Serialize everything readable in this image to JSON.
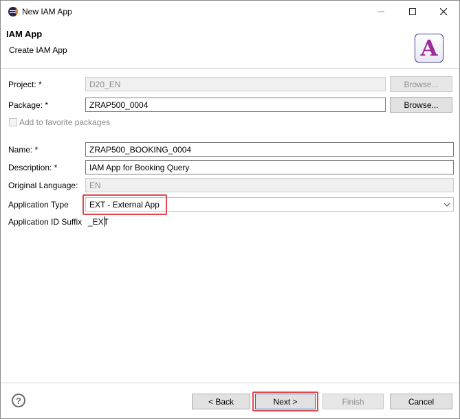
{
  "window": {
    "title": "New IAM App",
    "icon": "eclipse-icon"
  },
  "header": {
    "title": "IAM App",
    "subtitle": "Create IAM App",
    "logo_letter": "A"
  },
  "form": {
    "project": {
      "label": "Project: *",
      "value": "D20_EN",
      "browse_label": "Browse..."
    },
    "package": {
      "label": "Package: *",
      "value": "ZRAP500_0004",
      "browse_label": "Browse..."
    },
    "favorite": {
      "label": "Add to favorite packages",
      "checked": false
    },
    "name": {
      "label": "Name: *",
      "value": "ZRAP500_BOOKING_0004"
    },
    "description": {
      "label": "Description: *",
      "value": "IAM App for Booking Query"
    },
    "original_language": {
      "label": "Original Language:",
      "value": "EN"
    },
    "application_type": {
      "label": "Application Type",
      "value": "EXT - External App"
    },
    "application_id_suffix": {
      "label": "Application ID Suffix",
      "value": "_EXT"
    }
  },
  "footer": {
    "help": "?",
    "back_label": "< Back",
    "next_label": "Next >",
    "finish_label": "Finish",
    "cancel_label": "Cancel"
  },
  "colors": {
    "highlight": "#e0474c",
    "logo_letter": "#a02a9c"
  }
}
